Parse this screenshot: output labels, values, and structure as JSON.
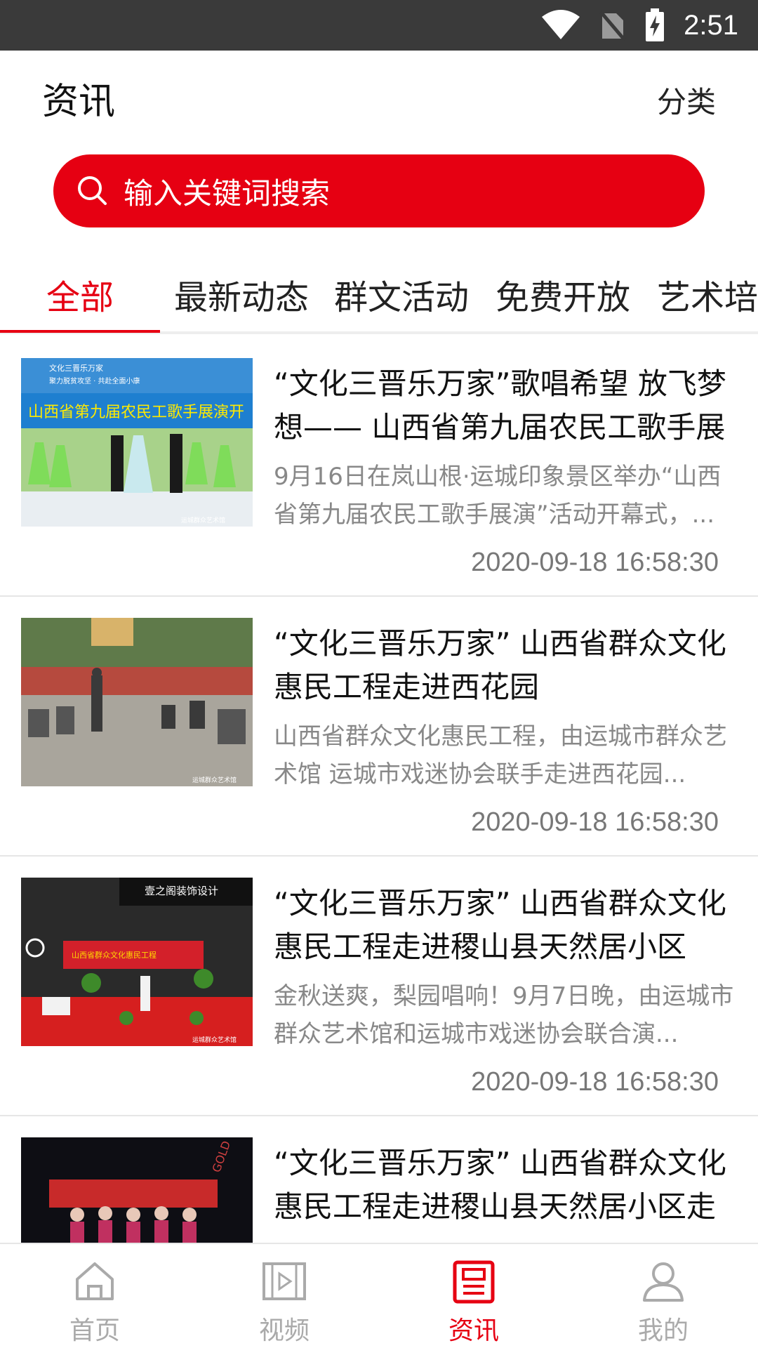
{
  "status_bar": {
    "time": "2:51"
  },
  "header": {
    "title": "资讯",
    "category_label": "分类"
  },
  "search": {
    "placeholder": "输入关键词搜索"
  },
  "tabs": [
    {
      "label": "全部",
      "active": true
    },
    {
      "label": "最新动态",
      "active": false
    },
    {
      "label": "群文活动",
      "active": false
    },
    {
      "label": "免费开放",
      "active": false
    },
    {
      "label": "艺术培",
      "active": false
    }
  ],
  "news": [
    {
      "title": "“文化三晋乐万家”歌唱希望 放飞梦想—— 山西省第九届农民工歌手展",
      "summary": "9月16日在岚山根·运城印象景区举办“山西省第九届农民工歌手展演”活动开幕式，...",
      "date": "2020-09-18 16:58:30",
      "thumb": {
        "banner_top": "文化三晋乐万家",
        "banner_sub": "聚力脱贫攻坚 · 共赴全面小康",
        "banner_main": "山西省第九届农民工歌手展演开",
        "watermark": "运城群众艺术馆"
      }
    },
    {
      "title": "“文化三晋乐万家” 山西省群众文化惠民工程走进西花园",
      "summary": "山西省群众文化惠民工程，由运城市群众艺术馆 运城市戏迷协会联手走进西花园...",
      "date": "2020-09-18 16:58:30",
      "thumb": {
        "watermark": "运城群众艺术馆"
      }
    },
    {
      "title": "“文化三晋乐万家” 山西省群众文化惠民工程走进稷山县天然居小区",
      "summary": "金秋送爽，梨园唱响！9月7日晚，由运城市群众艺术馆和运城市戏迷协会联合演...",
      "date": "2020-09-18 16:58:30",
      "thumb": {
        "sign": "壹之阁装饰设计",
        "banner": "山西省群众文化惠民工程",
        "watermark": "运城群众艺术馆"
      }
    },
    {
      "title": "“文化三晋乐万家” 山西省群众文化惠民工程走进稷山县天然居小区走",
      "summary": "",
      "date": "",
      "thumb": {
        "sign": "GOLD"
      }
    }
  ],
  "bottom_nav": [
    {
      "label": "首页",
      "icon": "home-icon",
      "active": false
    },
    {
      "label": "视频",
      "icon": "video-icon",
      "active": false
    },
    {
      "label": "资讯",
      "icon": "news-icon",
      "active": true
    },
    {
      "label": "我的",
      "icon": "user-icon",
      "active": false
    }
  ],
  "colors": {
    "accent": "#e60012",
    "inactive": "#aaaaaa",
    "status_bar": "#3a3a3a"
  }
}
